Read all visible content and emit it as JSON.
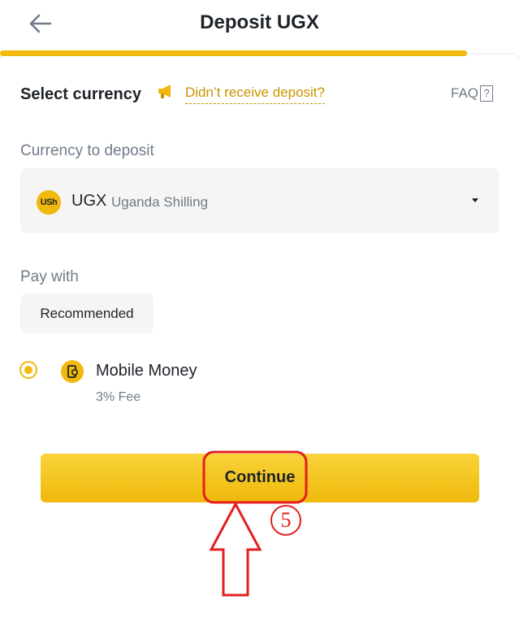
{
  "header": {
    "title": "Deposit UGX",
    "back_icon": "arrow-left-icon",
    "progress_fraction": 0.9
  },
  "currency_section": {
    "heading": "Select currency",
    "help_icon": "megaphone-icon",
    "help_link": "Didn’t receive deposit?",
    "faq_label": "FAQ",
    "faq_icon_text": "?"
  },
  "currency_field": {
    "label": "Currency to deposit",
    "coin_symbol": "USh",
    "code": "UGX",
    "name": "Uganda Shilling",
    "dropdown_icon": "caret-down-icon"
  },
  "payment": {
    "label": "Pay with",
    "filter_chip": "Recommended",
    "method_title": "Mobile Money",
    "method_fee": "3% Fee",
    "method_icon": "mobile-money-icon",
    "selected": true
  },
  "actions": {
    "continue_label": "Continue"
  },
  "annotation": {
    "step_number": "5",
    "highlight_color": "#e41e1e",
    "icon": "up-arrow-icon"
  },
  "colors": {
    "brand": "#f0b90b",
    "link": "#c99400",
    "text_primary": "#1e2329",
    "text_secondary": "#707a8a",
    "field_bg": "#f5f5f5"
  }
}
